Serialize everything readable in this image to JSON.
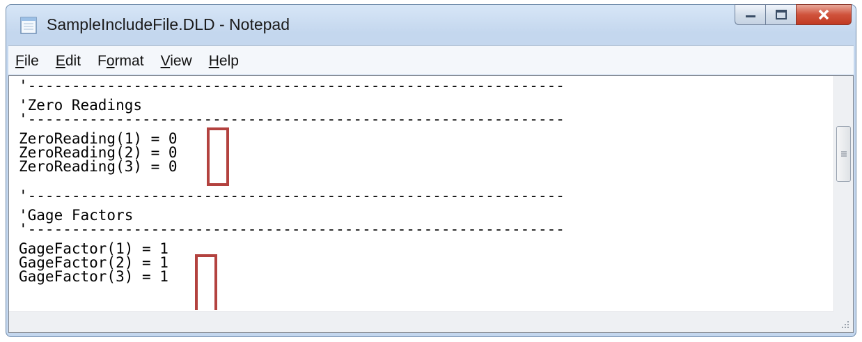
{
  "window": {
    "title": "SampleIncludeFile.DLD - Notepad"
  },
  "menu": [
    {
      "accel": "F",
      "rest": "ile"
    },
    {
      "accel": "E",
      "rest": "dit"
    },
    {
      "pre": "F",
      "accel": "o",
      "rest": "rmat"
    },
    {
      "accel": "V",
      "rest": "iew"
    },
    {
      "accel": "H",
      "rest": "elp"
    }
  ],
  "editor": {
    "lines": {
      "sep1": "'-------------------------------------------------------------",
      "zero_header": "'Zero Readings",
      "sep2": "'-------------------------------------------------------------",
      "zero1": "ZeroReading(1) = 0",
      "zero2": "ZeroReading(2) = 0",
      "zero3": "ZeroReading(3) = 0",
      "sep3": "'-------------------------------------------------------------",
      "gage_header": "'Gage Factors",
      "sep4": "'-------------------------------------------------------------",
      "gage1": "GageFactor(1) = 1",
      "gage2": "GageFactor(2) = 1",
      "gage3": "GageFactor(3) = 1"
    }
  },
  "icons": {
    "app": "notepad-icon",
    "minimize": "minimize-icon",
    "maximize": "maximize-icon",
    "close": "close-icon"
  },
  "colors": {
    "highlight_border": "#b3423f",
    "close_button": "#c8462f"
  }
}
